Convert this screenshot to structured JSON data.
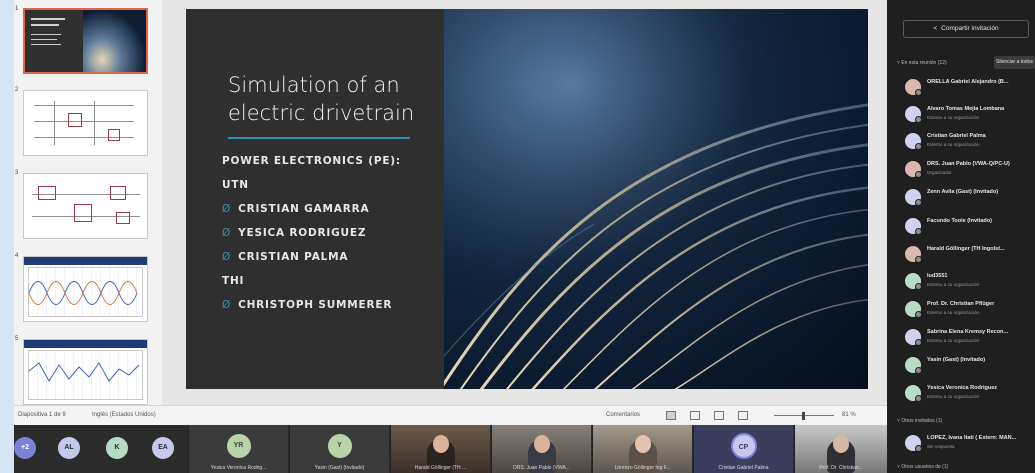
{
  "slide": {
    "title": "Simulation of an electric drivetrain",
    "lines": [
      {
        "text": "POWER ELECTRONICS (PE):",
        "bullet": false
      },
      {
        "text": "UTN",
        "bullet": false
      },
      {
        "text": "CRISTIAN GAMARRA",
        "bullet": true
      },
      {
        "text": "YESICA RODRIGUEZ",
        "bullet": true
      },
      {
        "text": "CRISTIAN PALMA",
        "bullet": true
      },
      {
        "text": "THI",
        "bullet": false
      },
      {
        "text": "CHRISTOPH SUMMERER",
        "bullet": true
      }
    ],
    "bullet_glyph": "Ø"
  },
  "thumbnails": {
    "numbers": [
      "1",
      "2",
      "3",
      "4",
      "5"
    ],
    "selected_index": 0
  },
  "status_bar": {
    "slide_info": "Diapositiva 1 de 9",
    "language": "Inglés (Estados Unidos)",
    "comments": "Comentarios",
    "zoom": "81 %"
  },
  "teams": {
    "invite_label": "Compartir invitación",
    "in_meeting_label": "En esta reunión (12)",
    "mute_all_label": "Silenciar a todos",
    "participants": [
      {
        "name": "ORELLA Gabriel Alejandro (B...",
        "sub": ""
      },
      {
        "name": "Alvaro Tomas Mejia Lombana",
        "sub": "Externo a su organización"
      },
      {
        "name": "Cristian Gabriel Palma",
        "sub": "Externo a su organización"
      },
      {
        "name": "DRS. Juan Pablo (VWA-Q/PC-U)",
        "sub": "Organizador"
      },
      {
        "name": "Zenn Avila (Gast) (Invitado)",
        "sub": ""
      },
      {
        "name": "Facundo Toole (Invitado)",
        "sub": ""
      },
      {
        "name": "Harald Göllinger (TH Ingolst...",
        "sub": ""
      },
      {
        "name": "lud3551",
        "sub": "Externo a su organización"
      },
      {
        "name": "Prof. Dr. Christian Pflüger",
        "sub": "Externo a su organización"
      },
      {
        "name": "Sabrina Elena Kremsy Recon...",
        "sub": "Externo a su organización"
      },
      {
        "name": "Yasin (Gast) (Invitado)",
        "sub": ""
      },
      {
        "name": "Yesica Veronica Rodriguez",
        "sub": "Externo a su organización"
      }
    ],
    "others_invited_label": "Otros invitados (1)",
    "invited": {
      "name": "LOPEZ, Ivana Itati ( Extern: MAN...",
      "sub": "Sin respuesta"
    },
    "others_attended_label": "Otros usuarios de (1)"
  },
  "bottom_strip": {
    "avatars": [
      {
        "initials": "+2",
        "color": "#7c83d6"
      },
      {
        "initials": "AL",
        "color": "#c3c8ef"
      },
      {
        "initials": "K",
        "color": "#b7dcc5"
      },
      {
        "initials": "EA",
        "color": "#c6c9f0"
      }
    ],
    "tiles": [
      {
        "initials": "YR",
        "name": "Yesica Veronica Rodrig..."
      },
      {
        "initials": "Y",
        "name": "Yasin (Gast) (Invitado)"
      },
      {
        "initials": "",
        "name": "Harald Göllinger (TH ..."
      },
      {
        "initials": "",
        "name": "DRS. Juan Pablo (VWA..."
      },
      {
        "initials": "",
        "name": "Lorenzo Göllinger Ing F..."
      },
      {
        "initials": "CP",
        "name": "Cristian Gabriel Palma"
      },
      {
        "initials": "",
        "name": "Prof. Dr. Christian..."
      }
    ]
  }
}
